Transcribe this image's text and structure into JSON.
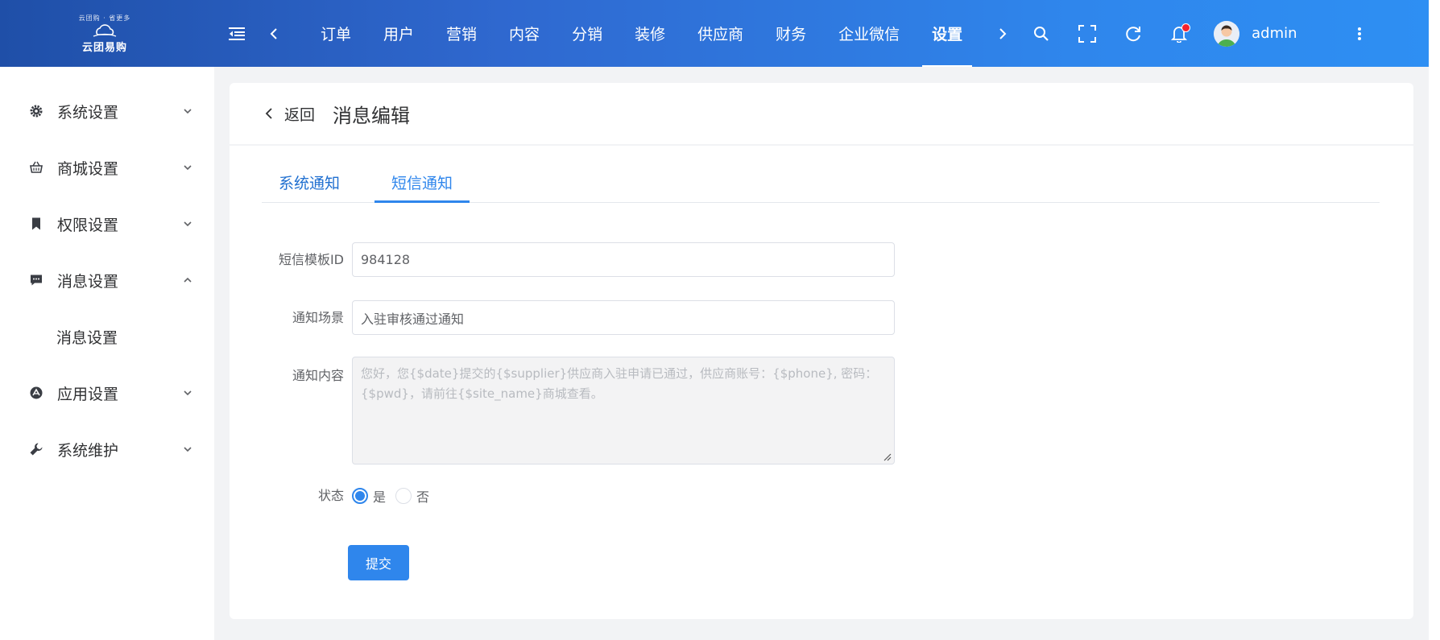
{
  "brand": {
    "tagline": "云团购 · 省更多",
    "name": "云团易购"
  },
  "nav": {
    "items": [
      {
        "label": "订单"
      },
      {
        "label": "用户"
      },
      {
        "label": "营销"
      },
      {
        "label": "内容"
      },
      {
        "label": "分销"
      },
      {
        "label": "装修"
      },
      {
        "label": "供应商"
      },
      {
        "label": "财务"
      },
      {
        "label": "企业微信"
      },
      {
        "label": "设置",
        "active": true
      }
    ]
  },
  "user": {
    "name": "admin"
  },
  "sidebar": {
    "items": [
      {
        "label": "系统设置",
        "icon": "gear-icon"
      },
      {
        "label": "商城设置",
        "icon": "basket-icon"
      },
      {
        "label": "权限设置",
        "icon": "bookmark-icon"
      },
      {
        "label": "消息设置",
        "icon": "message-icon",
        "expanded": true
      },
      {
        "label": "应用设置",
        "icon": "app-icon"
      },
      {
        "label": "系统维护",
        "icon": "wrench-icon"
      }
    ],
    "sub_item": "消息设置"
  },
  "page": {
    "back_label": "返回",
    "title": "消息编辑"
  },
  "tabs": [
    {
      "label": "系统通知"
    },
    {
      "label": "短信通知",
      "active": true
    }
  ],
  "form": {
    "template_id": {
      "label": "短信模板ID",
      "value": "984128"
    },
    "scene": {
      "label": "通知场景",
      "value": "入驻审核通过通知"
    },
    "content": {
      "label": "通知内容",
      "value": "您好，您{$date}提交的{$supplier}供应商入驻申请已通过，供应商账号：{$phone}, 密码：{$pwd}，请前往{$site_name}商城查看。"
    },
    "status": {
      "label": "状态",
      "options": [
        "是",
        "否"
      ],
      "selected": "是"
    },
    "submit_label": "提交"
  },
  "colors": {
    "primary": "#2f86ec",
    "header_start": "#1f4fa8",
    "header_end": "#2e8ff3",
    "badge": "#f5222d"
  }
}
